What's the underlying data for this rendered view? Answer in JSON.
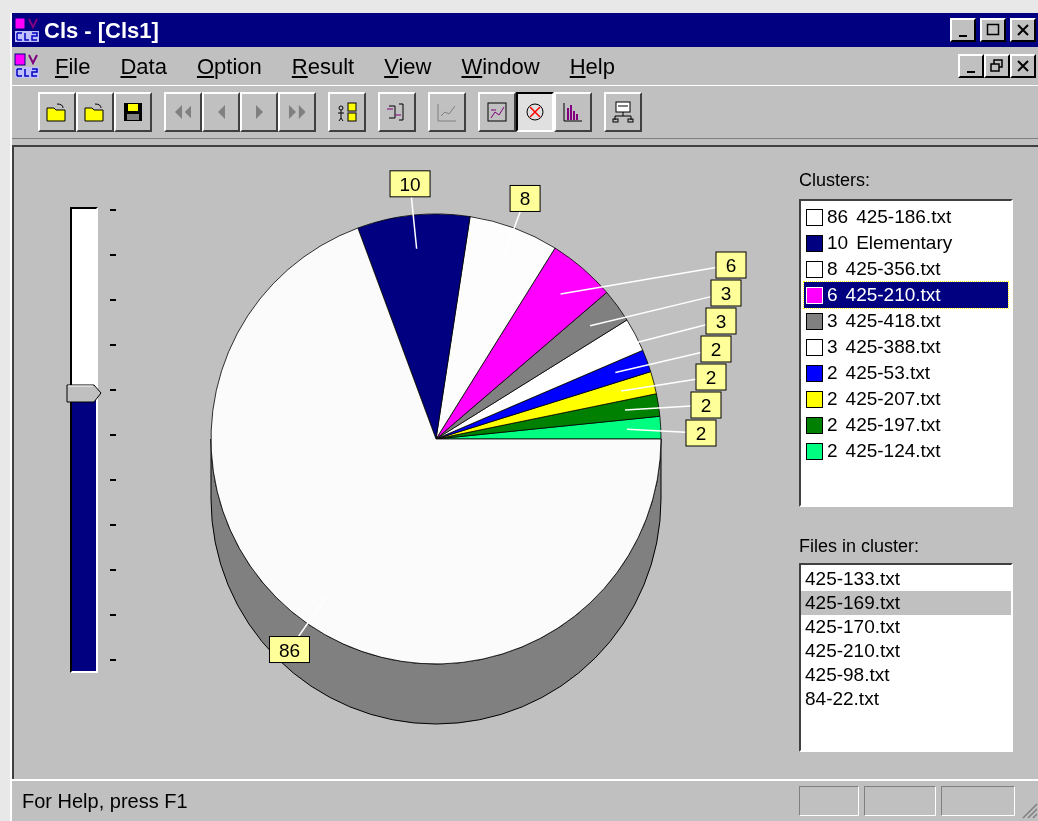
{
  "window": {
    "title": "Cls - [Cls1]"
  },
  "menu": [
    {
      "label": "File"
    },
    {
      "label": "Data"
    },
    {
      "label": "Option"
    },
    {
      "label": "Result"
    },
    {
      "label": "View"
    },
    {
      "label": "Window"
    },
    {
      "label": "Help"
    }
  ],
  "toolbar": [
    [
      {
        "disabled": false,
        "selected": false
      },
      {
        "disabled": false,
        "selected": false
      },
      {
        "disabled": false,
        "selected": false
      }
    ],
    [
      {
        "disabled": true,
        "selected": false
      },
      {
        "disabled": true,
        "selected": false
      },
      {
        "disabled": true,
        "selected": false
      },
      {
        "disabled": true,
        "selected": false
      }
    ],
    [
      {
        "disabled": false,
        "selected": false
      }
    ],
    [
      {
        "disabled": false,
        "selected": false
      }
    ],
    [
      {
        "disabled": true,
        "selected": false
      }
    ],
    [
      {
        "disabled": false,
        "selected": false
      },
      {
        "disabled": false,
        "selected": true
      },
      {
        "disabled": false,
        "selected": false
      }
    ],
    [
      {
        "disabled": false,
        "selected": false
      }
    ]
  ],
  "slider": {
    "level": 0.6
  },
  "chart": {
    "chart_data": {
      "type": "pie",
      "values": [
        2,
        2,
        2,
        2,
        3,
        3,
        6,
        8,
        10,
        86
      ],
      "data_labels": true
    }
  },
  "clusters": {
    "label": "Clusters:",
    "items": [
      {
        "count": "86",
        "name": "425-186.txt",
        "color": "#ffffff",
        "selected": false
      },
      {
        "count": "10",
        "name": "Elementary",
        "color": "#000080",
        "selected": false
      },
      {
        "count": "8",
        "name": "425-356.txt",
        "color": "#ffffff",
        "selected": false
      },
      {
        "count": "6",
        "name": "425-210.txt",
        "color": "#ff00ff",
        "selected": true
      },
      {
        "count": "3",
        "name": "425-418.txt",
        "color": "#808080",
        "selected": false
      },
      {
        "count": "3",
        "name": "425-388.txt",
        "color": "#ffffff",
        "selected": false
      },
      {
        "count": "2",
        "name": "425-53.txt",
        "color": "#0000ff",
        "selected": false
      },
      {
        "count": "2",
        "name": "425-207.txt",
        "color": "#ffff00",
        "selected": false
      },
      {
        "count": "2",
        "name": "425-197.txt",
        "color": "#008000",
        "selected": false
      },
      {
        "count": "2",
        "name": "425-124.txt",
        "color": "#00ff80",
        "selected": false
      }
    ]
  },
  "files": {
    "label": "Files in cluster:",
    "items": [
      {
        "name": "425-133.txt",
        "selected": false
      },
      {
        "name": "425-169.txt",
        "selected": true
      },
      {
        "name": "425-170.txt",
        "selected": false
      },
      {
        "name": "425-210.txt",
        "selected": false
      },
      {
        "name": "425-98.txt",
        "selected": false
      },
      {
        "name": "84-22.txt",
        "selected": false
      }
    ]
  },
  "status_bar": {
    "text": "For Help, press F1"
  }
}
